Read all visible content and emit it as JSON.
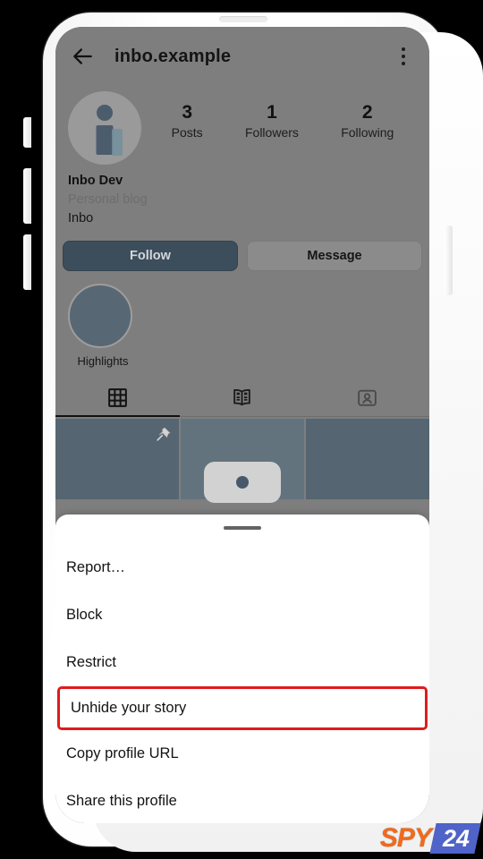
{
  "device": {
    "earpiece": "earpiece-speaker",
    "buttons": [
      "mute-switch",
      "volume-up",
      "volume-down",
      "power"
    ]
  },
  "appbar": {
    "back_icon": "back-arrow-icon",
    "title": "inbo.example",
    "menu_icon": "kebab-menu-icon"
  },
  "profile": {
    "avatar_icon": "profile-avatar-icon",
    "stats": [
      {
        "num": "3",
        "label": "Posts"
      },
      {
        "num": "1",
        "label": "Followers"
      },
      {
        "num": "2",
        "label": "Following"
      }
    ],
    "name": "Inbo Dev",
    "category": "Personal blog",
    "blurb": "Inbo",
    "follow_label": "Follow",
    "message_label": "Message",
    "highlights_label": "Highlights"
  },
  "tabs": [
    {
      "name": "grid",
      "icon": "grid-posts-icon",
      "active": true
    },
    {
      "name": "guides",
      "icon": "guides-book-icon",
      "active": false
    },
    {
      "name": "tagged",
      "icon": "tagged-person-icon",
      "active": false
    }
  ],
  "grid": [
    {
      "name": "post-thumbnail-1",
      "pinned": true
    },
    {
      "name": "post-thumbnail-2",
      "pinned": false
    },
    {
      "name": "post-thumbnail-3",
      "pinned": false
    }
  ],
  "sheet": {
    "grabber": "sheet-drag-handle",
    "items": [
      {
        "label": "Report…",
        "highlighted": false
      },
      {
        "label": "Block",
        "highlighted": false
      },
      {
        "label": "Restrict",
        "highlighted": false
      },
      {
        "label": "Unhide your story",
        "highlighted": true
      },
      {
        "label": "Copy profile URL",
        "highlighted": false
      },
      {
        "label": "Share this profile",
        "highlighted": false
      }
    ],
    "highlight_color": "#e01b1b"
  },
  "watermark": {
    "brand": "SPY",
    "suffix": "24",
    "brand_color": "#f26a1b",
    "suffix_bg": "#4f63c8"
  }
}
